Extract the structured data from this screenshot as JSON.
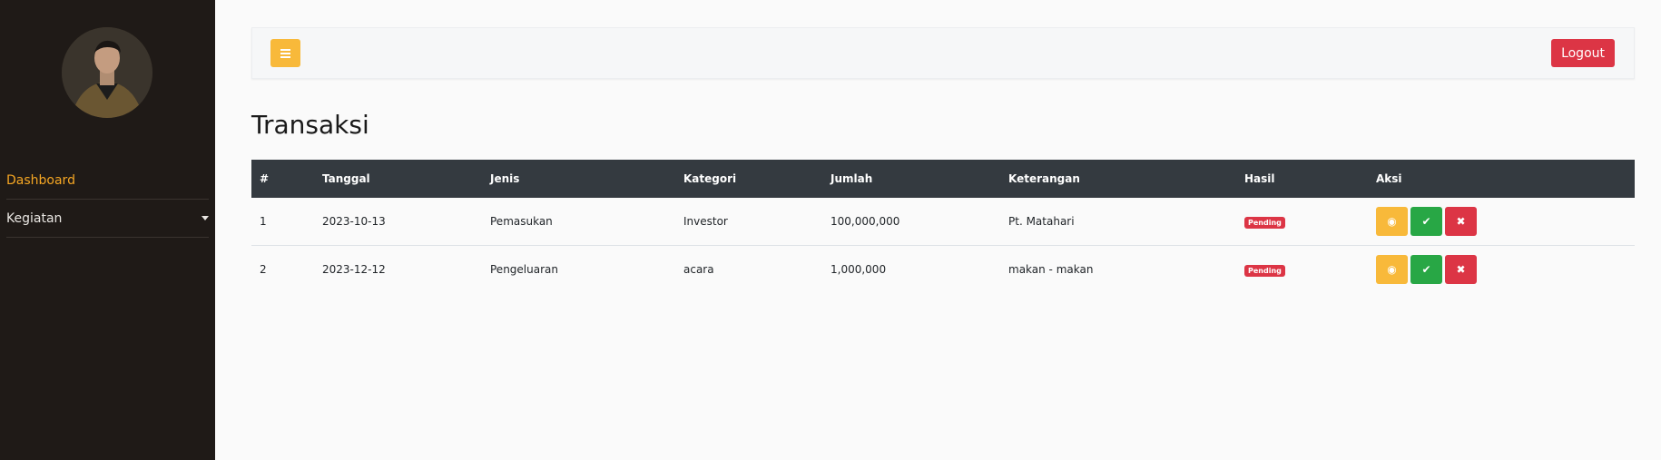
{
  "sidebar": {
    "items": [
      {
        "label": "Dashboard",
        "active": true
      },
      {
        "label": "Kegiatan",
        "has_dropdown": true
      }
    ]
  },
  "topbar": {
    "menu_icon": "bars-icon",
    "logout_label": "Logout"
  },
  "page_title": "Transaksi",
  "table": {
    "headers": [
      "#",
      "Tanggal",
      "Jenis",
      "Kategori",
      "Jumlah",
      "Keterangan",
      "Hasil",
      "Aksi"
    ],
    "rows": [
      {
        "no": "1",
        "tanggal": "2023-10-13",
        "jenis": "Pemasukan",
        "kategori": "Investor",
        "jumlah": "100,000,000",
        "keterangan": "Pt. Matahari",
        "hasil": "Pending"
      },
      {
        "no": "2",
        "tanggal": "2023-12-12",
        "jenis": "Pengeluaran",
        "kategori": "acara",
        "jumlah": "1,000,000",
        "keterangan": "makan - makan",
        "hasil": "Pending"
      }
    ],
    "action_icons": {
      "view": "eye-icon",
      "approve": "check-icon",
      "reject": "close-icon"
    },
    "action_glyphs": {
      "view": "◉",
      "approve": "✔",
      "reject": "✖"
    }
  },
  "colors": {
    "sidebar_bg": "#1f1a17",
    "accent": "#f5a623",
    "warning": "#f8b93a",
    "success": "#28a745",
    "danger": "#dc3545",
    "table_header": "#343a40"
  }
}
